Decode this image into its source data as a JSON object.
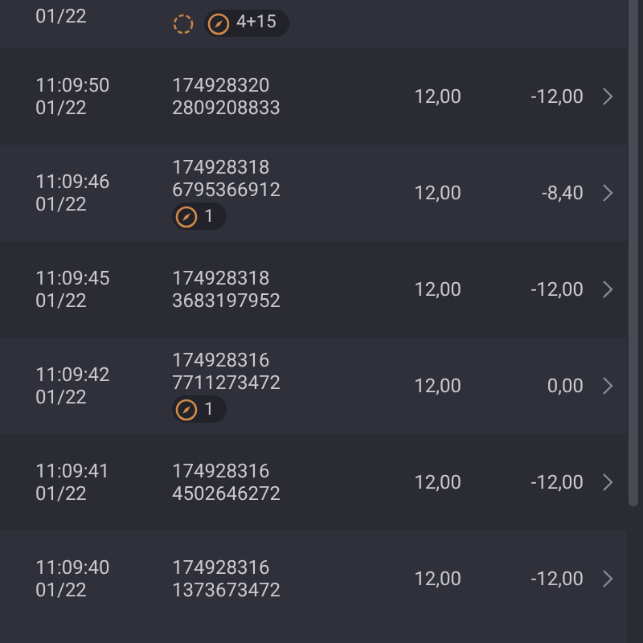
{
  "rows": [
    {
      "date": "01/22",
      "badges": [
        {
          "kind": "pending"
        },
        {
          "kind": "bonus",
          "count": "4+15"
        }
      ],
      "kind": "partial"
    },
    {
      "time": "11:09:50",
      "date": "01/22",
      "id_line1": "174928320",
      "id_line2": "2809208833",
      "badges": [],
      "amount": "12,00",
      "result": "-12,00"
    },
    {
      "time": "11:09:46",
      "date": "01/22",
      "id_line1": "174928318",
      "id_line2": "6795366912",
      "badges": [
        {
          "kind": "bonus",
          "count": "1"
        }
      ],
      "amount": "12,00",
      "result": "-8,40"
    },
    {
      "time": "11:09:45",
      "date": "01/22",
      "id_line1": "174928318",
      "id_line2": "3683197952",
      "badges": [],
      "amount": "12,00",
      "result": "-12,00"
    },
    {
      "time": "11:09:42",
      "date": "01/22",
      "id_line1": "174928316",
      "id_line2": "7711273472",
      "badges": [
        {
          "kind": "bonus",
          "count": "1"
        }
      ],
      "amount": "12,00",
      "result": "0,00"
    },
    {
      "time": "11:09:41",
      "date": "01/22",
      "id_line1": "174928316",
      "id_line2": "4502646272",
      "badges": [],
      "amount": "12,00",
      "result": "-12,00"
    },
    {
      "time": "11:09:40",
      "date": "01/22",
      "id_line1": "174928316",
      "id_line2": "1373673472",
      "badges": [],
      "amount": "12,00",
      "result": "-12,00"
    }
  ]
}
